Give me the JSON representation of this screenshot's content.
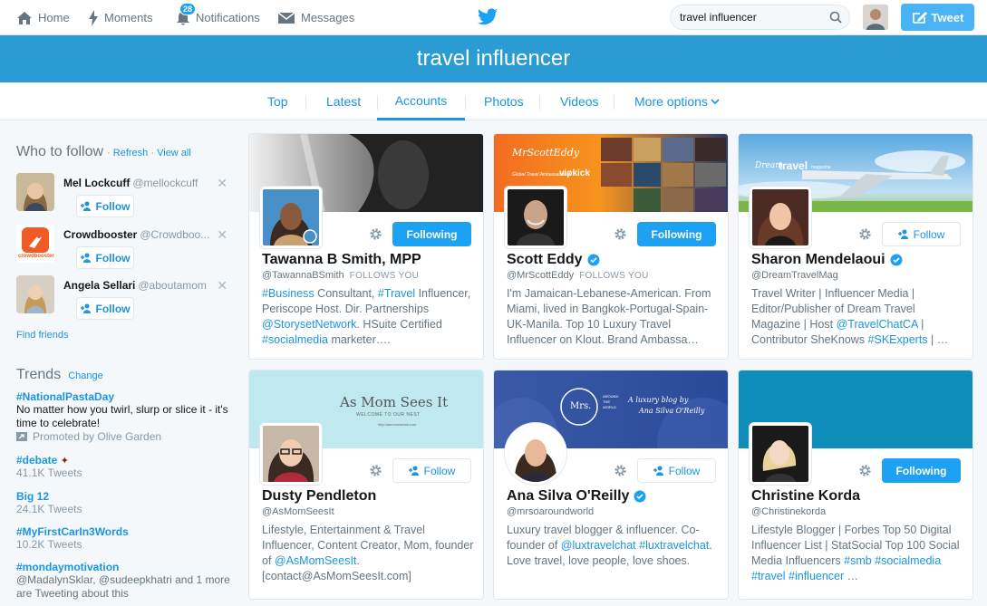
{
  "nav": {
    "home": "Home",
    "moments": "Moments",
    "notifications": "Notifications",
    "notifications_count": "28",
    "messages": "Messages",
    "tweet": "Tweet"
  },
  "search": {
    "value": "travel influencer"
  },
  "banner": {
    "title": "travel influencer"
  },
  "tabs": {
    "top": "Top",
    "latest": "Latest",
    "accounts": "Accounts",
    "photos": "Photos",
    "videos": "Videos",
    "more": "More options"
  },
  "who_to_follow": {
    "title": "Who to follow",
    "refresh": "Refresh",
    "dot": "·",
    "view_all": "View all",
    "follow_label": "Follow",
    "find_friends": "Find friends",
    "users": [
      {
        "name": "Mel Lockcuff",
        "handle": "@mellockcuff"
      },
      {
        "name": "Crowdbooster",
        "handle": "@Crowdboo..."
      },
      {
        "name": "Angela Sellari",
        "handle": "@aboutamom"
      }
    ],
    "crowdbooster_logo_text": "crowdbooster"
  },
  "trends": {
    "title": "Trends",
    "change": "Change",
    "items": [
      {
        "name": "#NationalPastaDay",
        "desc": "No matter how you twirl, slurp or slice it - it's time to celebrate!",
        "meta": "Promoted by Olive Garden"
      },
      {
        "name": "#debate",
        "meta": "41.1K Tweets"
      },
      {
        "name": "Big 12",
        "meta": "24.1K Tweets"
      },
      {
        "name": "#MyFirstCarIn3Words",
        "meta": "10.2K Tweets"
      },
      {
        "name": "#mondaymotivation",
        "desc": "@MadalynSklar, @sudeepkhatri and 1 more are Tweeting about this"
      }
    ]
  },
  "cards": [
    {
      "name": "Tawanna B Smith, MPP",
      "handle": "@TawannaBSmith",
      "follows_you": "FOLLOWS YOU",
      "button": "Following",
      "bio": [
        {
          "t": "#Business",
          "hl": true
        },
        {
          "t": " Consultant, "
        },
        {
          "t": "#Travel",
          "hl": true
        },
        {
          "t": " Influencer, Periscope Host. Dir. Partnerships "
        },
        {
          "t": "@StorysetNetwork",
          "hl": true
        },
        {
          "t": ". HSuite Certified "
        },
        {
          "t": "#socialmedia",
          "hl": true
        },
        {
          "t": " marketer…."
        }
      ]
    },
    {
      "name": "Scott Eddy",
      "handle": "@MrScottEddy",
      "follows_you": "FOLLOWS YOU",
      "button": "Following",
      "verified": true,
      "banner_text": "MrScottEddy",
      "banner_sub": "Global Travel Ambassador of",
      "banner_brand": "vipkick",
      "bio": [
        {
          "t": "I'm Jamaican-Lebanese-American. From Miami, lived in Bangkok-Portugal-Spain-UK-Manila. Top 10 Luxury Travel Influencer on Klout. Brand Ambassa…"
        }
      ]
    },
    {
      "name": "Sharon Mendelaoui",
      "handle": "@DreamTravelMag",
      "button": "Follow",
      "verified": true,
      "banner_text": "Dream",
      "banner_text2": "travel",
      "banner_text3": "magazine",
      "bio": [
        {
          "t": "Travel Writer | Influencer Media | Editor/Publisher of Dream Travel Magazine | Host "
        },
        {
          "t": "@TravelChatCA",
          "hl": true
        },
        {
          "t": " | Contributor SheKnows "
        },
        {
          "t": "#SKExperts",
          "hl": true
        },
        {
          "t": " | …"
        }
      ]
    },
    {
      "name": "Dusty Pendleton",
      "handle": "@AsMomSeesIt",
      "button": "Follow",
      "banner_text": "As Mom Sees It",
      "banner_sub": "WELCOME TO OUR NEST",
      "banner_url": "http://asmomseesit.com",
      "bio": [
        {
          "t": "Lifestyle, Entertainment & Travel Influencer, Content Creator, Mom, founder of "
        },
        {
          "t": "@AsMomSeesIt",
          "hl": true
        },
        {
          "t": ". [contact@AsMomSeesIt.com]"
        }
      ]
    },
    {
      "name": "Ana Silva O'Reilly",
      "handle": "@mrsoaroundworld",
      "button": "Follow",
      "verified": true,
      "banner_text": "A luxury blog by",
      "banner_sub": "Ana Silva O'Reilly",
      "banner_logo": "Mrs.",
      "banner_logo2": "AROUND THE WORLD",
      "bio": [
        {
          "t": "Luxury travel blogger & influencer. Co-founder of "
        },
        {
          "t": "@luxtravelchat",
          "hl": true
        },
        {
          "t": " "
        },
        {
          "t": "#luxtravelchat",
          "hl": true
        },
        {
          "t": ". Love travel, love people, love shoes."
        }
      ]
    },
    {
      "name": "Christine Korda",
      "handle": "@Christinekorda",
      "button": "Following",
      "bio": [
        {
          "t": "Lifestyle Blogger | Forbes Top 50 Digital Influencer List | StatSocial Top 100 Social Media Influencers "
        },
        {
          "t": "#smb",
          "hl": true
        },
        {
          "t": " "
        },
        {
          "t": "#socialmedia",
          "hl": true
        },
        {
          "t": " "
        },
        {
          "t": "#travel",
          "hl": true
        },
        {
          "t": " "
        },
        {
          "t": "#influencer",
          "hl": true
        },
        {
          "t": " …"
        }
      ]
    }
  ],
  "colors": {
    "accent": "#1da1f2",
    "banner": "#2b9bd3",
    "link": "#1b95e0"
  }
}
